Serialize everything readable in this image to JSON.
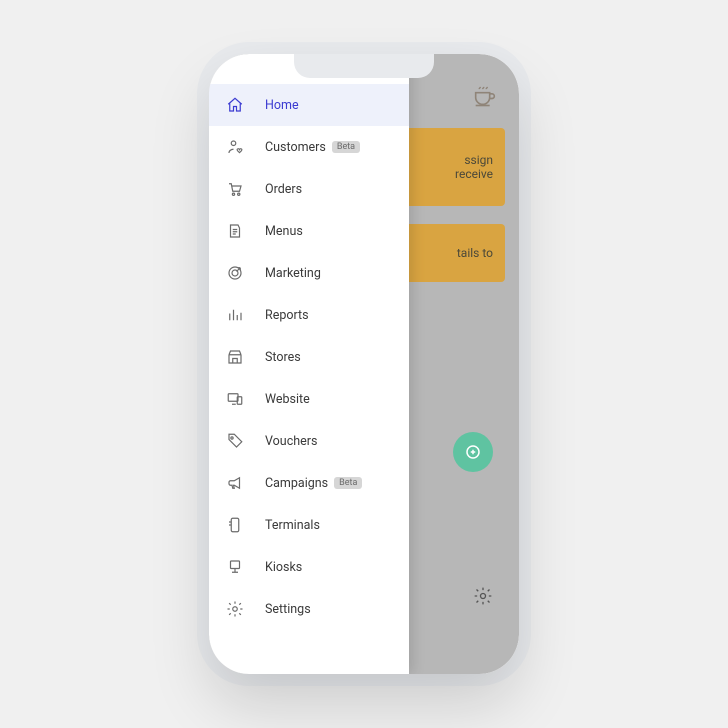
{
  "nav": [
    {
      "id": "home",
      "label": "Home",
      "badge": null,
      "active": true
    },
    {
      "id": "customers",
      "label": "Customers",
      "badge": "Beta",
      "active": false
    },
    {
      "id": "orders",
      "label": "Orders",
      "badge": null,
      "active": false
    },
    {
      "id": "menus",
      "label": "Menus",
      "badge": null,
      "active": false
    },
    {
      "id": "marketing",
      "label": "Marketing",
      "badge": null,
      "active": false
    },
    {
      "id": "reports",
      "label": "Reports",
      "badge": null,
      "active": false
    },
    {
      "id": "stores",
      "label": "Stores",
      "badge": null,
      "active": false
    },
    {
      "id": "website",
      "label": "Website",
      "badge": null,
      "active": false
    },
    {
      "id": "vouchers",
      "label": "Vouchers",
      "badge": null,
      "active": false
    },
    {
      "id": "campaigns",
      "label": "Campaigns",
      "badge": "Beta",
      "active": false
    },
    {
      "id": "terminals",
      "label": "Terminals",
      "badge": null,
      "active": false
    },
    {
      "id": "kiosks",
      "label": "Kiosks",
      "badge": null,
      "active": false
    },
    {
      "id": "settings",
      "label": "Settings",
      "badge": null,
      "active": false
    }
  ],
  "cards": {
    "notice1a": "ssign",
    "notice1b": "receive",
    "notice2": "tails to"
  }
}
